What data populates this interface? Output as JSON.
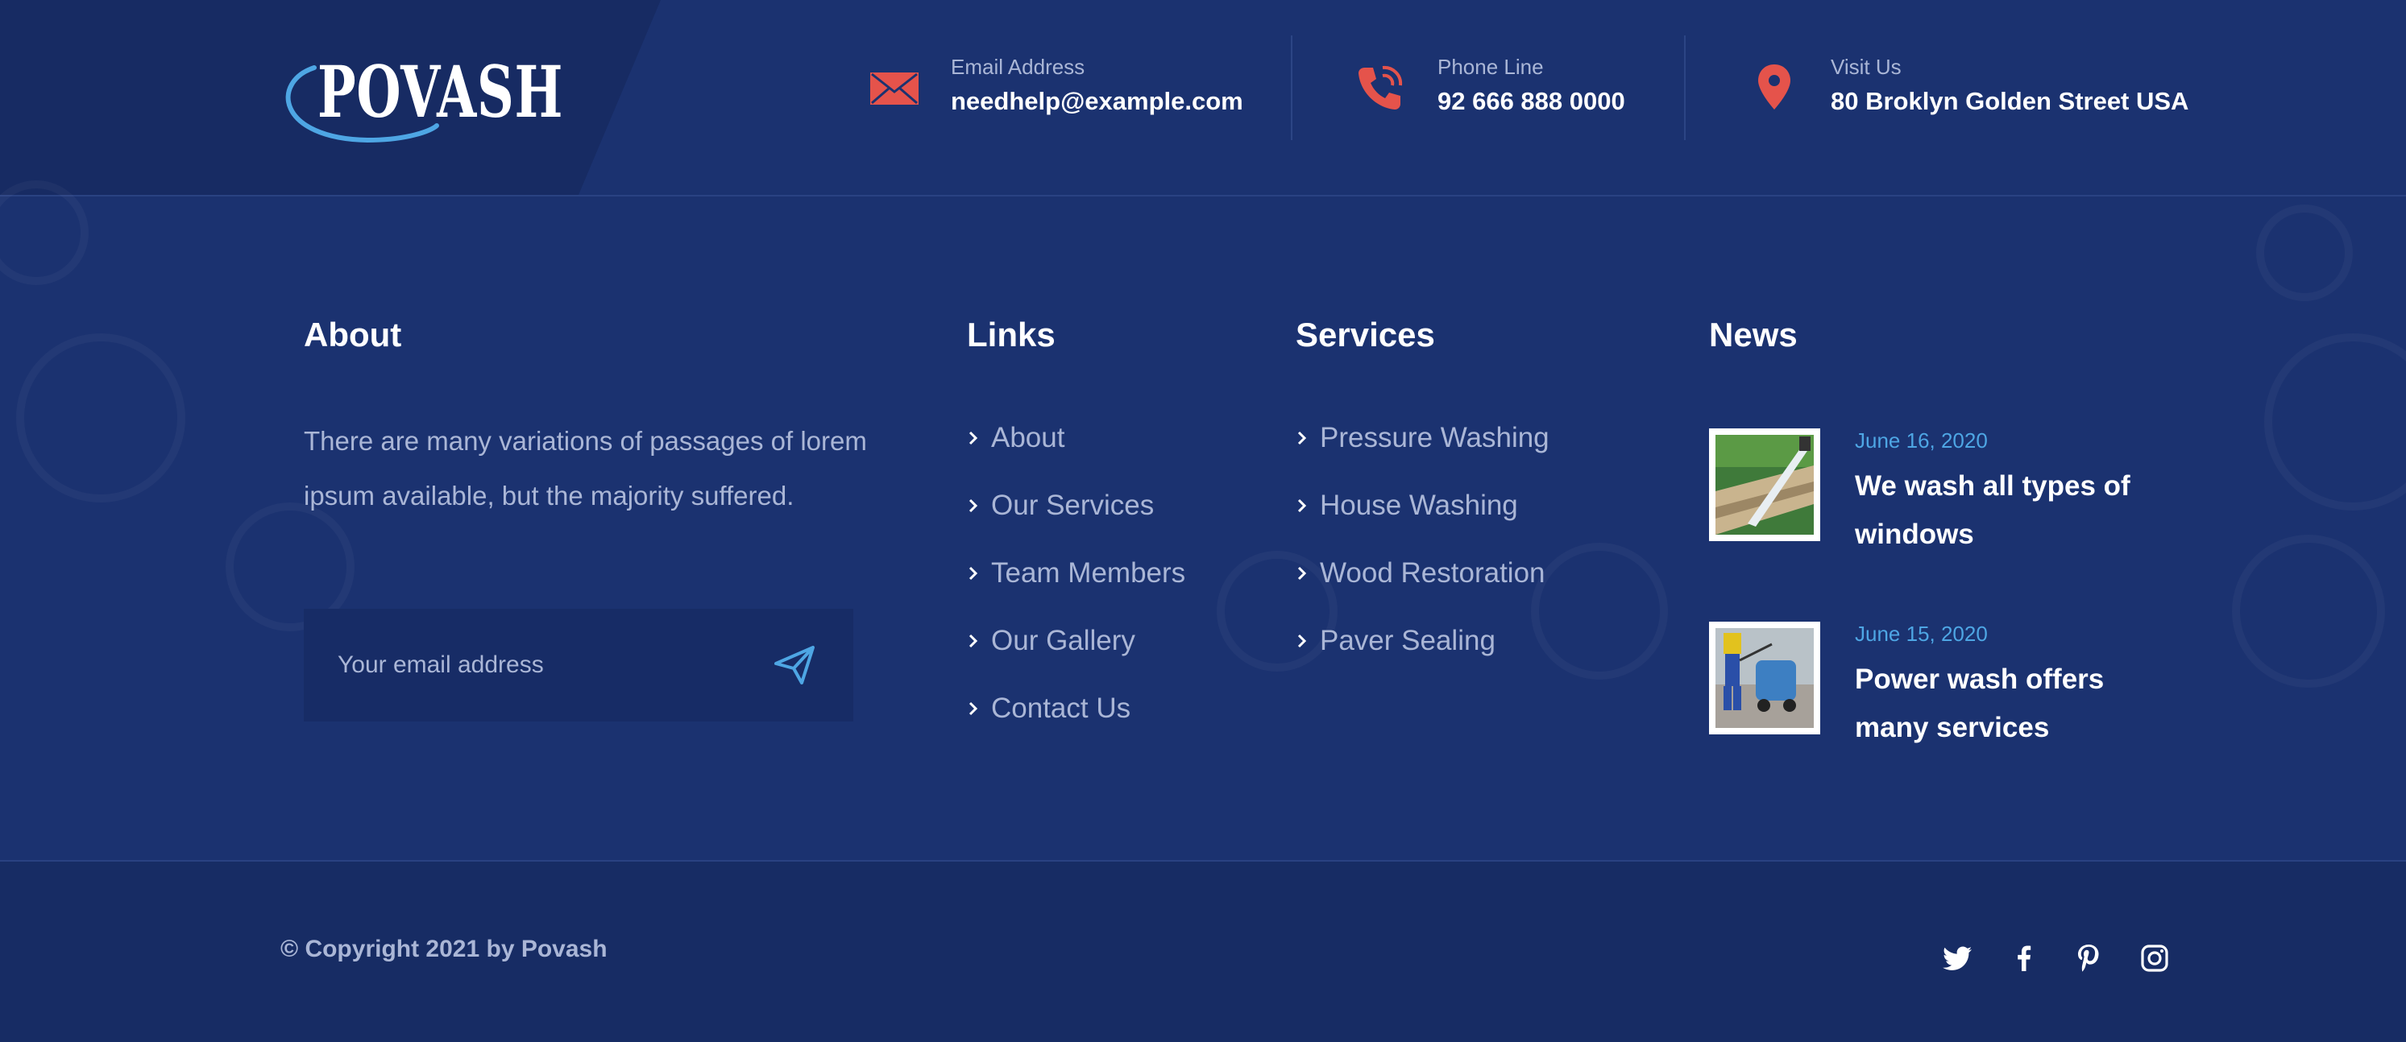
{
  "brand": {
    "name": "POVASH"
  },
  "contacts": [
    {
      "label": "Email Address",
      "value": "needhelp@example.com",
      "icon": "envelope-icon"
    },
    {
      "label": "Phone Line",
      "value": "92 666 888 0000",
      "icon": "phone-icon"
    },
    {
      "label": "Visit Us",
      "value": "80 Broklyn Golden Street USA",
      "icon": "map-pin-icon"
    }
  ],
  "about": {
    "title": "About",
    "text": "There are many variations of passages of lorem ipsum available, but the majority suffered.",
    "email_placeholder": "Your email address"
  },
  "links": {
    "title": "Links",
    "items": [
      "About",
      "Our Services",
      "Team Members",
      "Our Gallery",
      "Contact Us"
    ]
  },
  "services": {
    "title": "Services",
    "items": [
      "Pressure Washing",
      "House Washing",
      "Wood Restoration",
      "Paver Sealing"
    ]
  },
  "news": {
    "title": "News",
    "items": [
      {
        "date": "June 16, 2020",
        "title": "We wash all types of windows"
      },
      {
        "date": "June 15, 2020",
        "title": "Power wash offers many services"
      }
    ]
  },
  "footer": {
    "copyright": "© Copyright 2021 by Povash",
    "social": [
      "twitter-icon",
      "facebook-icon",
      "pinterest-icon",
      "instagram-icon"
    ]
  },
  "colors": {
    "background": "#1b3270",
    "accent_red": "#e5534b",
    "accent_blue": "#4ea6e4",
    "muted_text": "#aab6d6"
  }
}
